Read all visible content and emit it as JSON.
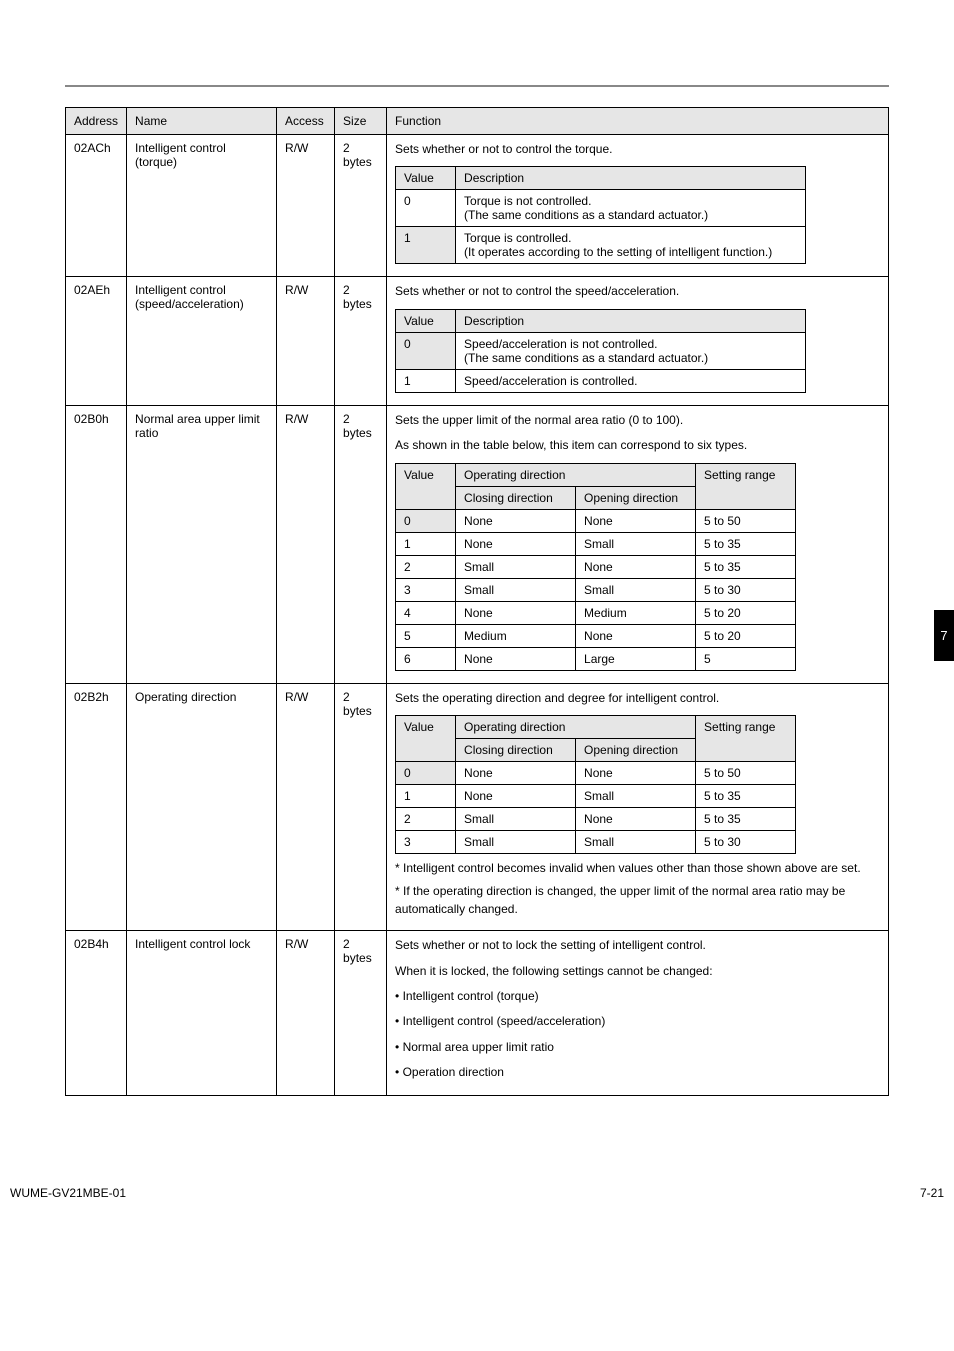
{
  "side_tab": "7",
  "main": {
    "headers": {
      "address": "Address",
      "name": "Name",
      "access": "Access",
      "size": "Size",
      "function": "Function"
    },
    "rows": [
      {
        "address": "02ACh",
        "name": "Intelligent control (torque)",
        "access": "R/W",
        "size": "2 bytes",
        "intro": "Sets whether or not to control the torque.",
        "inner": {
          "type": "value_desc",
          "headers": {
            "value": "Value",
            "desc": "Description"
          },
          "items": [
            {
              "value": "0",
              "desc": "Torque is not controlled.\n(The same conditions as a standard actuator.)",
              "default": false
            },
            {
              "value": "1",
              "desc": "Torque is controlled.\n(It operates according to the setting of intelligent function.)",
              "default": true
            }
          ]
        }
      },
      {
        "address": "02AEh",
        "name": "Intelligent control (speed/acceleration)",
        "access": "R/W",
        "size": "2 bytes",
        "intro": "Sets whether or not to control the speed/acceleration.",
        "inner": {
          "type": "value_desc",
          "headers": {
            "value": "Value",
            "desc": "Description"
          },
          "items": [
            {
              "value": "0",
              "desc": "Speed/acceleration is not controlled.\n(The same conditions as a standard actuator.)",
              "default": true
            },
            {
              "value": "1",
              "desc": "Speed/acceleration is controlled.",
              "default": false
            }
          ]
        }
      },
      {
        "address": "02B0h",
        "name": "Normal area upper limit ratio",
        "access": "R/W",
        "size": "2 bytes",
        "intro": "Sets the upper limit of the normal area ratio (0 to 100).\nAs shown in the table below, this item can correspond to six types.",
        "inner": {
          "type": "dir_range",
          "headers": {
            "value": "Value",
            "dir": "Operating direction",
            "close": "Closing direction",
            "open": "Opening direction",
            "range": "Setting range"
          },
          "items": [
            {
              "value": "0",
              "close": "None",
              "open": "None",
              "range": "5 to 50",
              "default": true
            },
            {
              "value": "1",
              "close": "None",
              "open": "Small",
              "range": "5 to 35"
            },
            {
              "value": "2",
              "close": "Small",
              "open": "None",
              "range": "5 to 35"
            },
            {
              "value": "3",
              "close": "Small",
              "open": "Small",
              "range": "5 to 30"
            },
            {
              "value": "4",
              "close": "None",
              "open": "Medium",
              "range": "5 to 20"
            },
            {
              "value": "5",
              "close": "Medium",
              "open": "None",
              "range": "5 to 20"
            },
            {
              "value": "6",
              "close": "None",
              "open": "Large",
              "range": "5"
            }
          ]
        }
      },
      {
        "address": "02B2h",
        "name": "Operating direction",
        "access": "R/W",
        "size": "2 bytes",
        "intro": "Sets the operating direction and degree for intelligent control.",
        "inner": {
          "type": "dir_range",
          "headers": {
            "value": "Value",
            "dir": "Operating direction",
            "close": "Closing direction",
            "open": "Opening direction",
            "range": "Setting range"
          },
          "items": [
            {
              "value": "0",
              "close": "None",
              "open": "None",
              "range": "5 to 50",
              "default": true
            },
            {
              "value": "1",
              "close": "None",
              "open": "Small",
              "range": "5 to 35"
            },
            {
              "value": "2",
              "close": "Small",
              "open": "None",
              "range": "5 to 35"
            },
            {
              "value": "3",
              "close": "Small",
              "open": "Small",
              "range": "5 to 30"
            }
          ]
        },
        "notes": "* Intelligent control becomes invalid when values other than those shown above are set.\n* If the operating direction is changed, the upper limit of the normal area ratio may be automatically changed."
      },
      {
        "address": "02B4h",
        "name": "Intelligent control lock",
        "access": "R/W",
        "size": "2 bytes",
        "intro": "Sets whether or not to lock the setting of intelligent control.\nWhen it is locked, the following settings cannot be changed:\n• Intelligent control (torque)\n• Intelligent control (speed/acceleration)\n• Normal area upper limit ratio\n• Operation direction"
      }
    ]
  },
  "footer": {
    "left": "WUME-GV21MBE-01",
    "right": "7-21"
  }
}
